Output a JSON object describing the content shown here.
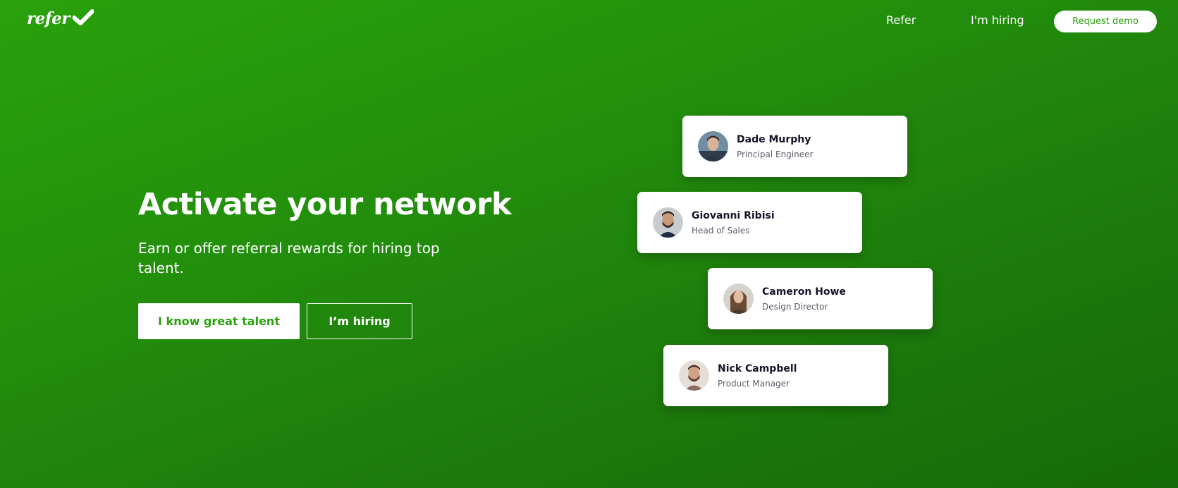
{
  "header": {
    "logo_text": "refer",
    "nav": [
      {
        "label": "Refer"
      },
      {
        "label": "I'm hiring"
      }
    ],
    "demo_label": "Request demo"
  },
  "hero": {
    "title": "Activate your network",
    "subtitle": "Earn or offer referral rewards for hiring top talent.",
    "primary_label": "I know great talent",
    "secondary_label": "I’m hiring"
  },
  "cards": [
    {
      "name": "Dade Murphy",
      "role": "Principal Engineer"
    },
    {
      "name": "Giovanni Ribisi",
      "role": "Head of Sales"
    },
    {
      "name": "Cameron Howe",
      "role": "Design Director"
    },
    {
      "name": "Nick Campbell",
      "role": "Product Manager"
    }
  ],
  "colors": {
    "accent": "#2aa10c",
    "background_start": "#2aa10c",
    "background_end": "#166a09",
    "card_name": "#15152a",
    "card_role": "#5c5c6a"
  },
  "icons": {
    "logo_mark": "check-icon",
    "avatars": [
      "avatar-photo",
      "avatar-photo",
      "avatar-photo",
      "avatar-photo"
    ]
  }
}
